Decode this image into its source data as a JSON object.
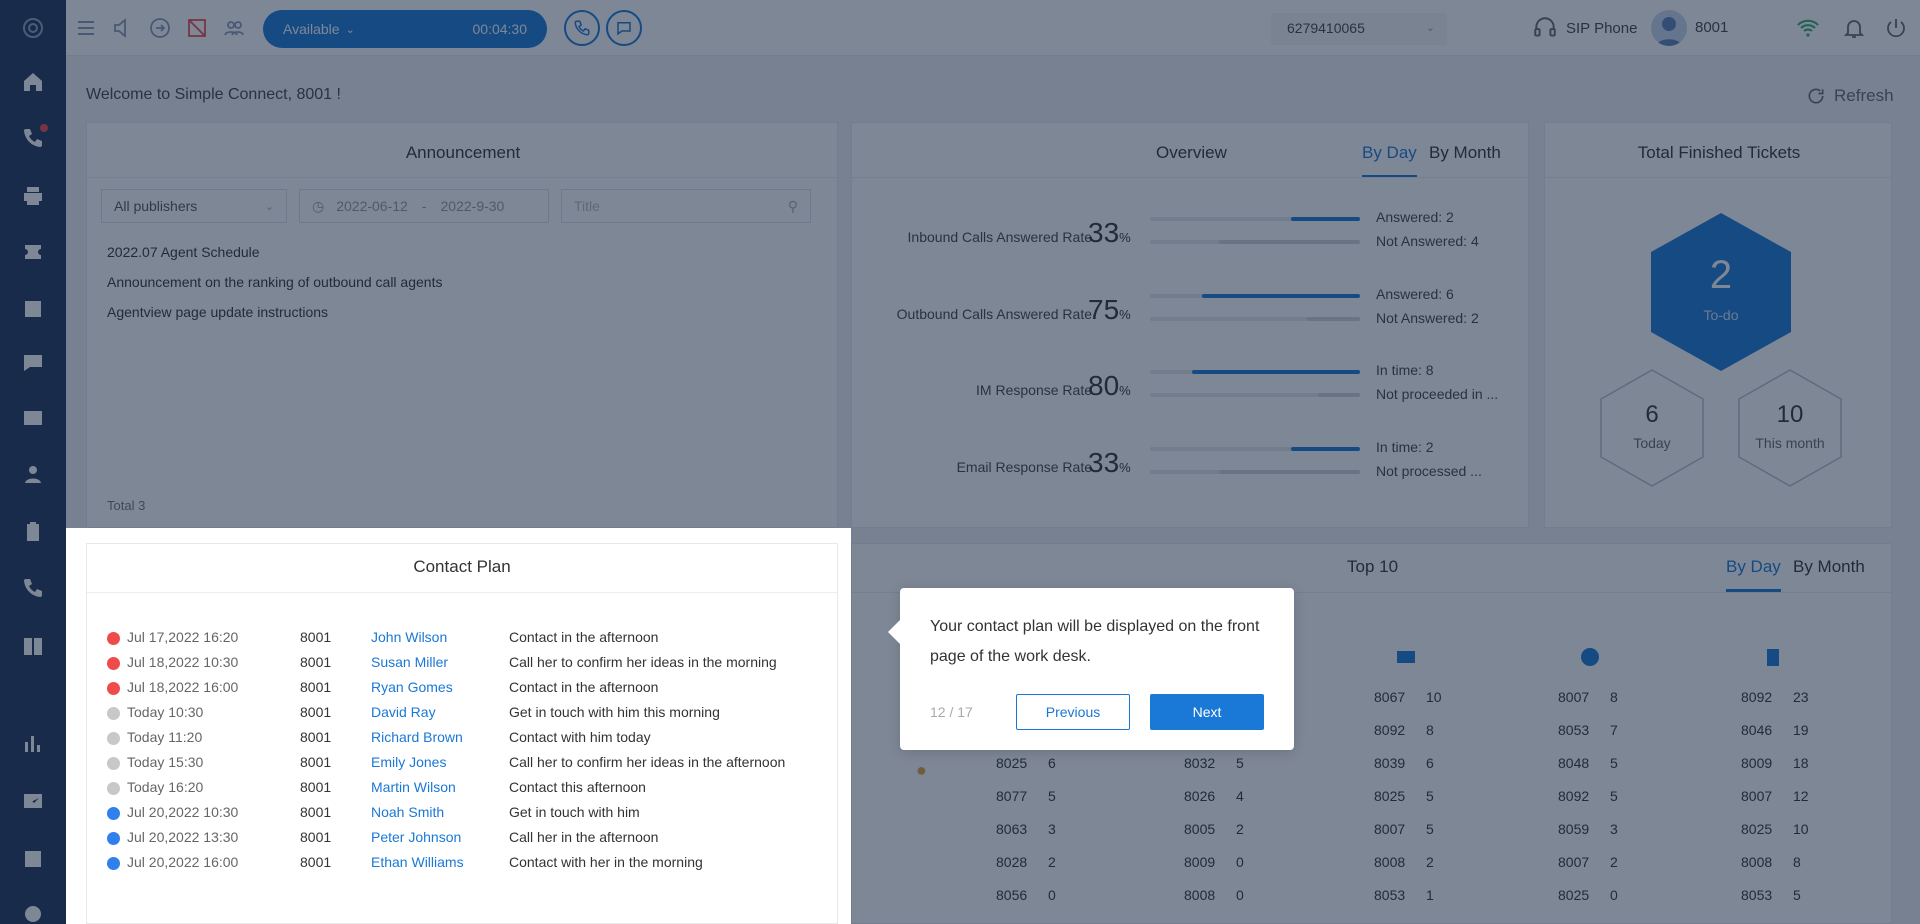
{
  "colors": {
    "accent": "#1a78d6",
    "sidebar": "#1d3358",
    "red": "#f04b4b",
    "grey": "#c8c8c8",
    "blue": "#2f80ed"
  },
  "sidebar": {
    "items": [
      {
        "icon": "logo-icon"
      },
      {
        "icon": "home-icon"
      },
      {
        "icon": "phone-icon"
      },
      {
        "icon": "printer-icon"
      },
      {
        "icon": "ticket-icon"
      },
      {
        "icon": "calendar-icon"
      },
      {
        "icon": "chat-icon"
      },
      {
        "icon": "mail-icon"
      },
      {
        "icon": "contact-icon"
      },
      {
        "icon": "clipboard-icon"
      },
      {
        "icon": "callback-icon"
      },
      {
        "icon": "book-icon"
      },
      {
        "icon": "report-icon"
      },
      {
        "icon": "monitor-icon"
      },
      {
        "icon": "schedule-icon"
      },
      {
        "icon": "settings-icon"
      }
    ]
  },
  "topbar": {
    "status": "Available",
    "timer": "00:04:30",
    "number": "6279410065",
    "sip_label": "SIP Phone",
    "user_ext": "8001"
  },
  "welcome": "Welcome to Simple Connect, 8001 !",
  "refresh": "Refresh",
  "announcement": {
    "title": "Announcement",
    "publisher_filter": "All publishers",
    "date_start": "2022-06-12",
    "date_sep": "-",
    "date_end": "2022-9-30",
    "title_placeholder": "Title",
    "items": [
      "2022.07 Agent Schedule",
      "Announcement on the ranking of outbound call agents",
      "Agentview page update instructions"
    ],
    "total": "Total 3"
  },
  "overview": {
    "title": "Overview",
    "tab_day": "By Day",
    "tab_month": "By Month",
    "metrics": [
      {
        "label": "Inbound Calls Answered Rate",
        "value": "33",
        "unit": "%",
        "line1": "Answered: 2",
        "line2": "Not Answered: 4",
        "fill1": 0.33,
        "fill2": 0.67
      },
      {
        "label": "Outbound Calls Answered Rate",
        "value": "75",
        "unit": "%",
        "line1": "Answered: 6",
        "line2": "Not Answered: 2",
        "fill1": 0.75,
        "fill2": 0.25
      },
      {
        "label": "IM Response Rate",
        "value": "80",
        "unit": "%",
        "line1": "In time: 8",
        "line2": "Not proceeded in ...",
        "fill1": 0.8,
        "fill2": 0.2
      },
      {
        "label": "Email Response Rate",
        "value": "33",
        "unit": "%",
        "line1": "In time: 2",
        "line2": "Not processed ...",
        "fill1": 0.33,
        "fill2": 0.67
      }
    ]
  },
  "tickets": {
    "title": "Total Finished Tickets",
    "todo_value": "2",
    "todo_label": "To-do",
    "today_value": "6",
    "today_label": "Today",
    "month_value": "10",
    "month_label": "This month"
  },
  "contact_plan": {
    "title": "Contact Plan",
    "rows": [
      {
        "status": "red",
        "date": "Jul 17,2022 16:20",
        "ext": "8001",
        "name": "John Wilson",
        "note": "Contact in the afternoon"
      },
      {
        "status": "red",
        "date": "Jul 18,2022 10:30",
        "ext": "8001",
        "name": "Susan Miller",
        "note": "Call her to confirm her ideas in the morning"
      },
      {
        "status": "red",
        "date": "Jul 18,2022 16:00",
        "ext": "8001",
        "name": "Ryan Gomes",
        "note": "Contact in the afternoon"
      },
      {
        "status": "grey",
        "date": "Today 10:30",
        "ext": "8001",
        "name": "David Ray",
        "note": "Get in touch with him this morning"
      },
      {
        "status": "grey",
        "date": "Today 11:20",
        "ext": "8001",
        "name": "Richard Brown",
        "note": "Contact with him today"
      },
      {
        "status": "grey",
        "date": "Today 15:30",
        "ext": "8001",
        "name": "Emily Jones",
        "note": "Call her to confirm her ideas in the afternoon"
      },
      {
        "status": "grey",
        "date": "Today 16:20",
        "ext": "8001",
        "name": "Martin Wilson",
        "note": "Contact this afternoon"
      },
      {
        "status": "blue",
        "date": "Jul 20,2022 10:30",
        "ext": "8001",
        "name": "Noah Smith",
        "note": "Get in touch with him"
      },
      {
        "status": "blue",
        "date": "Jul 20,2022 13:30",
        "ext": "8001",
        "name": "Peter Johnson",
        "note": "Call her in the afternoon"
      },
      {
        "status": "blue",
        "date": "Jul 20,2022 16:00",
        "ext": "8001",
        "name": "Ethan Williams",
        "note": "Contact with her in the morning"
      }
    ]
  },
  "top10": {
    "title": "Top 10",
    "tab_day": "By Day",
    "tab_month": "By Month",
    "columns": [
      {
        "icon": "",
        "rows": [
          [
            "8025",
            "6"
          ],
          [
            "8077",
            "5"
          ],
          [
            "8063",
            "3"
          ],
          [
            "8028",
            "2"
          ],
          [
            "8056",
            "0"
          ]
        ]
      },
      {
        "icon": "",
        "rows": [
          [
            "8032",
            "5"
          ],
          [
            "8026",
            "4"
          ],
          [
            "8005",
            "2"
          ],
          [
            "8009",
            "0"
          ],
          [
            "8008",
            "0"
          ]
        ]
      },
      {
        "icon": "mail-icon",
        "rows": [
          [
            "8067",
            "10"
          ],
          [
            "8092",
            "8"
          ],
          [
            "8039",
            "6"
          ],
          [
            "8025",
            "5"
          ],
          [
            "8007",
            "5"
          ],
          [
            "8008",
            "2"
          ],
          [
            "8053",
            "1"
          ]
        ]
      },
      {
        "icon": "chat-icon",
        "rows": [
          [
            "8007",
            "8"
          ],
          [
            "8053",
            "7"
          ],
          [
            "8048",
            "5"
          ],
          [
            "8092",
            "5"
          ],
          [
            "8059",
            "3"
          ],
          [
            "8007",
            "2"
          ],
          [
            "8025",
            "0"
          ]
        ]
      },
      {
        "icon": "clipboard-icon",
        "rows": [
          [
            "8092",
            "23"
          ],
          [
            "8046",
            "19"
          ],
          [
            "8009",
            "18"
          ],
          [
            "8007",
            "12"
          ],
          [
            "8025",
            "10"
          ],
          [
            "8008",
            "8"
          ],
          [
            "8053",
            "5"
          ]
        ]
      }
    ]
  },
  "tour": {
    "text": "Your contact plan will be displayed on the front page of the work desk.",
    "step": "12 / 17",
    "prev": "Previous",
    "next": "Next"
  }
}
